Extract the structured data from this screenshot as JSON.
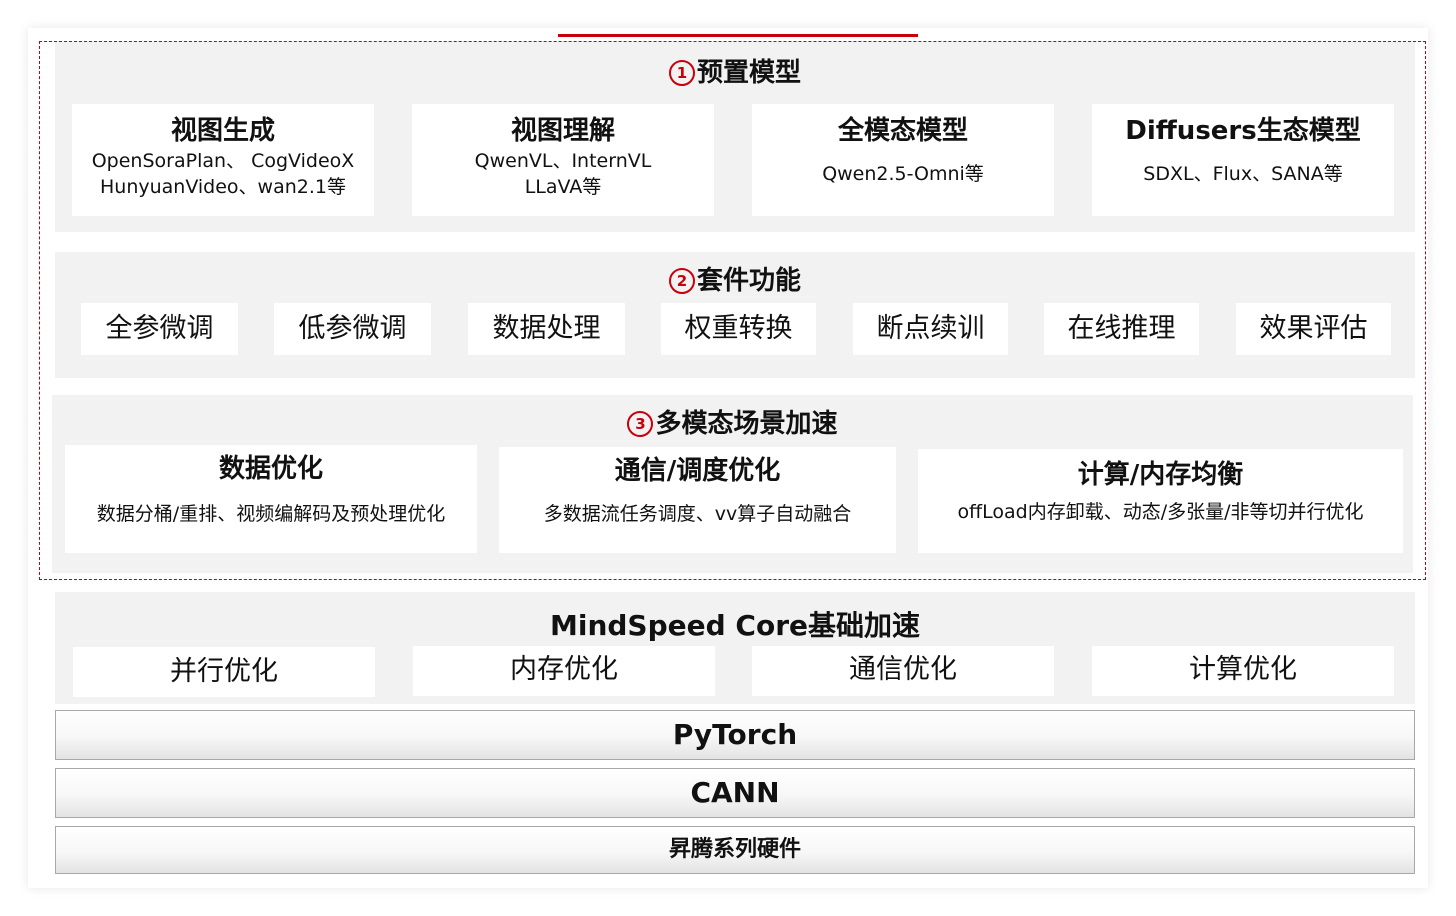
{
  "section1": {
    "num": "1",
    "title": "预置模型",
    "cards": [
      {
        "title": "视图生成",
        "lines": [
          "OpenSoraPlan、 CogVideoX",
          "HunyuanVideo、wan2.1等"
        ]
      },
      {
        "title": "视图理解",
        "lines": [
          "QwenVL、InternVL",
          "LLaVA等"
        ]
      },
      {
        "title": "全模态模型",
        "lines": [
          "Qwen2.5-Omni等"
        ]
      },
      {
        "title": "Diffusers生态模型",
        "lines": [
          "SDXL、Flux、SANA等"
        ]
      }
    ]
  },
  "section2": {
    "num": "2",
    "title": "套件功能",
    "items": [
      "全参微调",
      "低参微调",
      "数据处理",
      "权重转换",
      "断点续训",
      "在线推理",
      "效果评估"
    ]
  },
  "section3": {
    "num": "3",
    "title": "多模态场景加速",
    "cards": [
      {
        "title": "数据优化",
        "desc": "数据分桶/重排、视频编解码及预处理优化"
      },
      {
        "title": "通信/调度优化",
        "desc": "多数据流任务调度、vv算子自动融合"
      },
      {
        "title": "计算/内存均衡",
        "desc": "offLoad内存卸载、动态/多张量/非等切并行优化"
      }
    ]
  },
  "core": {
    "title": "MindSpeed Core基础加速",
    "items": [
      "并行优化",
      "内存优化",
      "通信优化",
      "计算优化"
    ]
  },
  "stack": [
    "PyTorch",
    "CANN",
    "昇腾系列硬件"
  ],
  "colors": {
    "accent": "#c7000b",
    "panel": "#f2f2f2"
  }
}
